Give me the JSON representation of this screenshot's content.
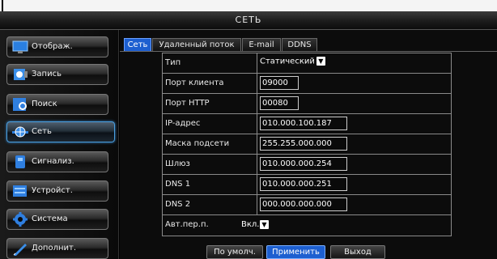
{
  "window": {
    "title": "СЕТЬ"
  },
  "sidebar": {
    "items": [
      {
        "label": "Отображ.",
        "icon": "monitor-icon"
      },
      {
        "label": "Запись",
        "icon": "record-icon"
      },
      {
        "label": "Поиск",
        "icon": "search-icon"
      },
      {
        "label": "Сеть",
        "icon": "network-globe-icon",
        "active": true
      },
      {
        "label": "Сигнализ.",
        "icon": "alarm-icon"
      },
      {
        "label": "Устройст.",
        "icon": "device-icon"
      },
      {
        "label": "Система",
        "icon": "system-gear-icon"
      },
      {
        "label": "Дополнит.",
        "icon": "advanced-pen-icon"
      }
    ]
  },
  "tabs": [
    {
      "label": "Сеть",
      "active": true
    },
    {
      "label": "Удаленный поток"
    },
    {
      "label": "E-mail"
    },
    {
      "label": "DDNS"
    }
  ],
  "form": {
    "type_label": "Тип",
    "type_value": "Статический",
    "client_port_label": "Порт клиента",
    "client_port_value": "09000",
    "http_port_label": "Порт HTTP",
    "http_port_value": "00080",
    "ip_label": "IP-адрес",
    "ip_value": "010.000.100.187",
    "mask_label": "Маска подсети",
    "mask_value": "255.255.000.000",
    "gateway_label": "Шлюз",
    "gateway_value": "010.000.000.254",
    "dns1_label": "DNS 1",
    "dns1_value": "010.000.000.251",
    "dns2_label": "DNS 2",
    "dns2_value": "000.000.000.000",
    "auto_label": "Авт.пер.п.",
    "auto_value": "Вкл."
  },
  "buttons": {
    "default": "По умолч.",
    "apply": "Применить",
    "exit": "Выход"
  },
  "colors": {
    "accent": "#1d5fd0",
    "highlight": "#4aa0e0"
  }
}
